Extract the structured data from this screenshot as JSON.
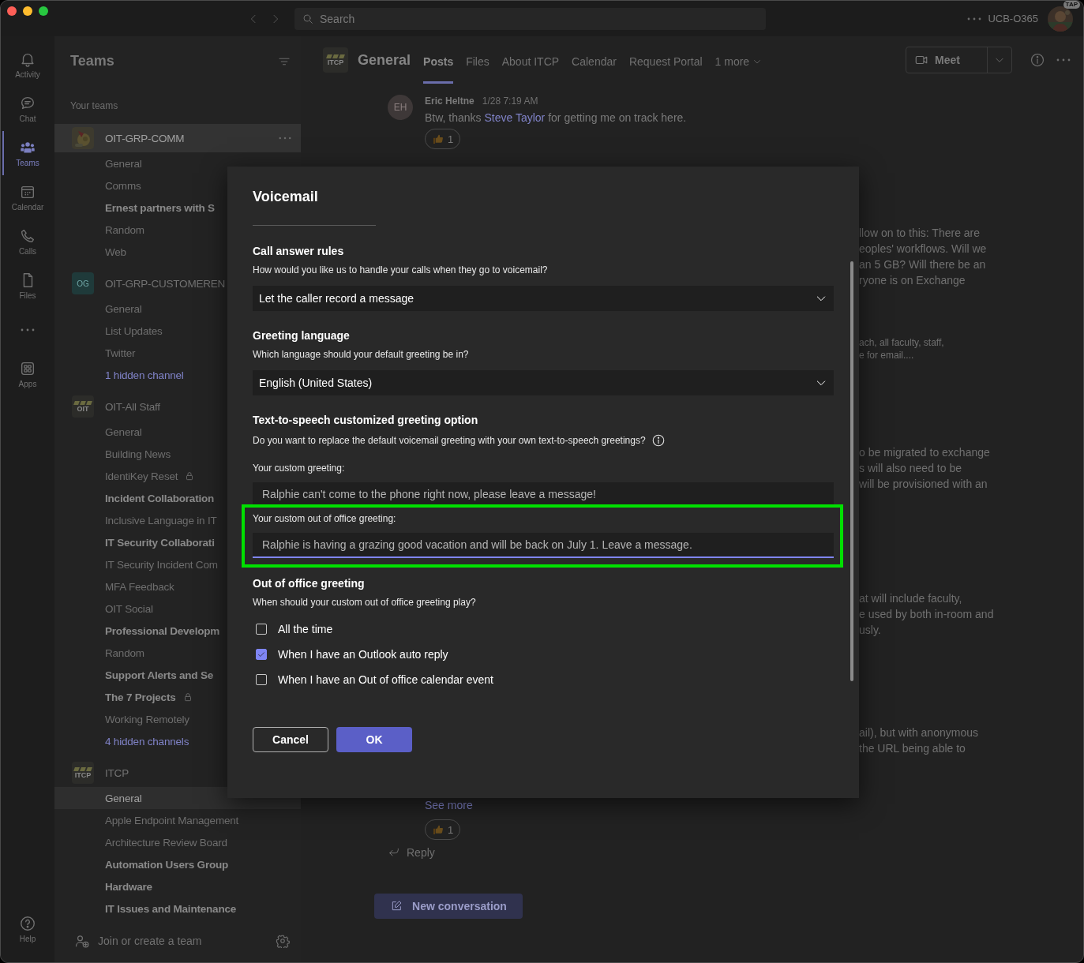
{
  "window": {
    "search": {
      "placeholder": "Search"
    },
    "account": {
      "name": "UCB-O365",
      "badge": "TAP"
    }
  },
  "app_bar": [
    {
      "kind": "activity",
      "label": "Activity",
      "selected": false
    },
    {
      "kind": "chat",
      "label": "Chat",
      "selected": false
    },
    {
      "kind": "teams",
      "label": "Teams",
      "selected": true
    },
    {
      "kind": "calendar",
      "label": "Calendar",
      "selected": false
    },
    {
      "kind": "calls",
      "label": "Calls",
      "selected": false
    },
    {
      "kind": "files",
      "label": "Files",
      "selected": false
    },
    {
      "kind": "more",
      "selected": false
    },
    {
      "kind": "apps",
      "label": "Apps",
      "selected": false
    }
  ],
  "help": {
    "label": "Help"
  },
  "teams_panel": {
    "title": "Teams",
    "section": "Your teams",
    "join": "Join or create a team",
    "teams": [
      {
        "name": "OIT-GRP-COMM",
        "avatar": {
          "kind": "picture"
        },
        "hovered": true,
        "channels": [
          {
            "name": "General",
            "unread": false,
            "locked": false,
            "selected": false
          },
          {
            "name": "Comms",
            "unread": false,
            "locked": false,
            "selected": false
          },
          {
            "name": "Ernest partners with S",
            "unread": true,
            "locked": false,
            "selected": false
          },
          {
            "name": "Random",
            "unread": false,
            "locked": false,
            "selected": false
          },
          {
            "name": "Web",
            "unread": false,
            "locked": false,
            "selected": false
          }
        ]
      },
      {
        "name": "OIT-GRP-CUSTOMEREN",
        "avatar": {
          "kind": "initials",
          "text": "OG"
        },
        "hovered": false,
        "hidden": "1 hidden channel",
        "channels": [
          {
            "name": "General",
            "unread": false,
            "locked": false,
            "selected": false
          },
          {
            "name": "List Updates",
            "unread": false,
            "locked": false,
            "selected": false
          },
          {
            "name": "Twitter",
            "unread": false,
            "locked": false,
            "selected": false
          }
        ]
      },
      {
        "name": "OIT-All Staff",
        "avatar": {
          "kind": "logo",
          "text": "OIT"
        },
        "hovered": false,
        "hidden": "4 hidden channels",
        "channels": [
          {
            "name": "General",
            "unread": false,
            "locked": false,
            "selected": false
          },
          {
            "name": "Building News",
            "unread": false,
            "locked": false,
            "selected": false
          },
          {
            "name": "IdentiKey Reset",
            "unread": false,
            "locked": true,
            "selected": false
          },
          {
            "name": "Incident Collaboration",
            "unread": true,
            "locked": false,
            "selected": false
          },
          {
            "name": "Inclusive Language in IT",
            "unread": false,
            "locked": false,
            "selected": false
          },
          {
            "name": "IT Security Collaborati",
            "unread": true,
            "locked": false,
            "selected": false
          },
          {
            "name": "IT Security Incident Com",
            "unread": false,
            "locked": false,
            "selected": false
          },
          {
            "name": "MFA Feedback",
            "unread": false,
            "locked": false,
            "selected": false
          },
          {
            "name": "OIT Social",
            "unread": false,
            "locked": false,
            "selected": false
          },
          {
            "name": "Professional Developm",
            "unread": true,
            "locked": false,
            "selected": false
          },
          {
            "name": "Random",
            "unread": false,
            "locked": false,
            "selected": false
          },
          {
            "name": "Support Alerts and Se",
            "unread": true,
            "locked": false,
            "selected": false
          },
          {
            "name": "The 7 Projects",
            "unread": true,
            "locked": true,
            "selected": false
          },
          {
            "name": "Working Remotely",
            "unread": false,
            "locked": false,
            "selected": false
          }
        ]
      },
      {
        "name": "ITCP",
        "avatar": {
          "kind": "logo",
          "text": "ITCP"
        },
        "hovered": false,
        "channels": [
          {
            "name": "General",
            "unread": false,
            "locked": false,
            "selected": true
          },
          {
            "name": "Apple Endpoint Management",
            "unread": false,
            "locked": false,
            "selected": false
          },
          {
            "name": "Architecture Review Board",
            "unread": false,
            "locked": false,
            "selected": false
          },
          {
            "name": "Automation Users Group",
            "unread": true,
            "locked": false,
            "selected": false
          },
          {
            "name": "Hardware",
            "unread": true,
            "locked": false,
            "selected": false
          },
          {
            "name": "IT Issues and Maintenance",
            "unread": true,
            "locked": false,
            "selected": false
          }
        ]
      }
    ]
  },
  "channel_header": {
    "logo": "ITCP",
    "title": "General",
    "meet": "Meet",
    "tabs": [
      {
        "label": "Posts",
        "kind": "tab",
        "selected": true
      },
      {
        "label": "Files",
        "kind": "tab",
        "selected": false
      },
      {
        "label": "About ITCP",
        "kind": "tab",
        "selected": false
      },
      {
        "label": "Calendar",
        "kind": "tab",
        "selected": false
      },
      {
        "label": "Request Portal",
        "kind": "tab",
        "selected": false
      },
      {
        "label": "1 more",
        "kind": "overflow",
        "selected": false
      }
    ]
  },
  "feed": {
    "message": {
      "initials": "EH",
      "author": "Eric Heltne",
      "time": "1/28 7:19 AM",
      "text_before": "Btw, thanks ",
      "mention": "Steve Taylor",
      "text_after": " for getting me on track here.",
      "reactions": [
        {
          "count": "1"
        }
      ]
    },
    "excerpts": [
      {
        "kind": "normal",
        "text": "llow on to this: There are\neoples' workflows. Will we\nan 5 GB? Will there be an\nryone is on Exchange"
      },
      {
        "kind": "small",
        "text": "ach, all faculty, staff,\ne for email...."
      },
      {
        "kind": "normal",
        "text": "o be migrated to exchange\ns will also need to be\nwill be provisioned with an"
      },
      {
        "kind": "normal",
        "text": "at will include faculty,\ne used by both in-room and\nusly."
      },
      {
        "kind": "normal",
        "text": "ail), but with anonymous\nthe URL being able to"
      }
    ],
    "see_more": "See more",
    "reactions": [
      {
        "count": "1"
      }
    ],
    "reply": "Reply",
    "new_conversation": "New conversation"
  },
  "dialog": {
    "title": "Voicemail",
    "call_answer": {
      "heading": "Call answer rules",
      "prompt": "How would you like us to handle your calls when they go to voicemail?",
      "value": "Let the caller record a message"
    },
    "greeting_language": {
      "heading": "Greeting language",
      "prompt": "Which language should your default greeting be in?",
      "value": "English (United States)"
    },
    "tts": {
      "heading": "Text-to-speech customized greeting option",
      "prompt": "Do you want to replace the default voicemail greeting with your own text-to-speech greetings?",
      "greeting_label": "Your custom greeting:",
      "greeting_value": "Ralphie can't come to the phone right now, please leave a message!",
      "ooo_label": "Your custom out of office greeting:",
      "ooo_value": "Ralphie is having a grazing good vacation and will be back on July 1. Leave a message.",
      "ooo_focused": true,
      "ooo_highlighted": true
    },
    "ooo": {
      "heading": "Out of office greeting",
      "prompt": "When should your custom out of office greeting play?",
      "options": [
        {
          "label": "All the time",
          "checked": false
        },
        {
          "label": "When I have an Outlook auto reply",
          "checked": true
        },
        {
          "label": "When I have an Out of office calendar event",
          "checked": false
        }
      ]
    },
    "buttons": [
      {
        "label": "Cancel",
        "kind": "secondary"
      },
      {
        "label": "OK",
        "kind": "primary"
      }
    ]
  }
}
